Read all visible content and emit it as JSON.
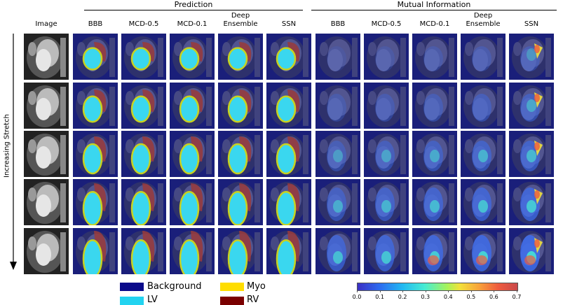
{
  "groups": {
    "prediction": "Prediction",
    "mutual_information": "Mutual Information"
  },
  "columns": {
    "image": "Image",
    "pred": [
      "BBB",
      "MCD-0.5",
      "MCD-0.1",
      "Deep\nEnsemble",
      "SSN"
    ],
    "mi": [
      "BBB",
      "MCD-0.5",
      "MCD-0.1",
      "Deep\nEnsemble",
      "SSN"
    ]
  },
  "side_label": "Increasing Stretch",
  "legend": {
    "items": [
      {
        "label": "Background",
        "color": "#0a0a8a"
      },
      {
        "label": "Myo",
        "color": "#ffdd00"
      },
      {
        "label": "LV",
        "color": "#22d3f0"
      },
      {
        "label": "RV",
        "color": "#7a0000"
      }
    ]
  },
  "colorbar": {
    "colormap": "jet",
    "ticks": [
      "0.0",
      "0.1",
      "0.2",
      "0.3",
      "0.4",
      "0.5",
      "0.6",
      "0.7"
    ]
  },
  "colors": {
    "background_overlay": "#1a1f7a",
    "lv": "#3ad7ef",
    "myo": "#c8d21e",
    "rv": "#9a3b3b"
  }
}
